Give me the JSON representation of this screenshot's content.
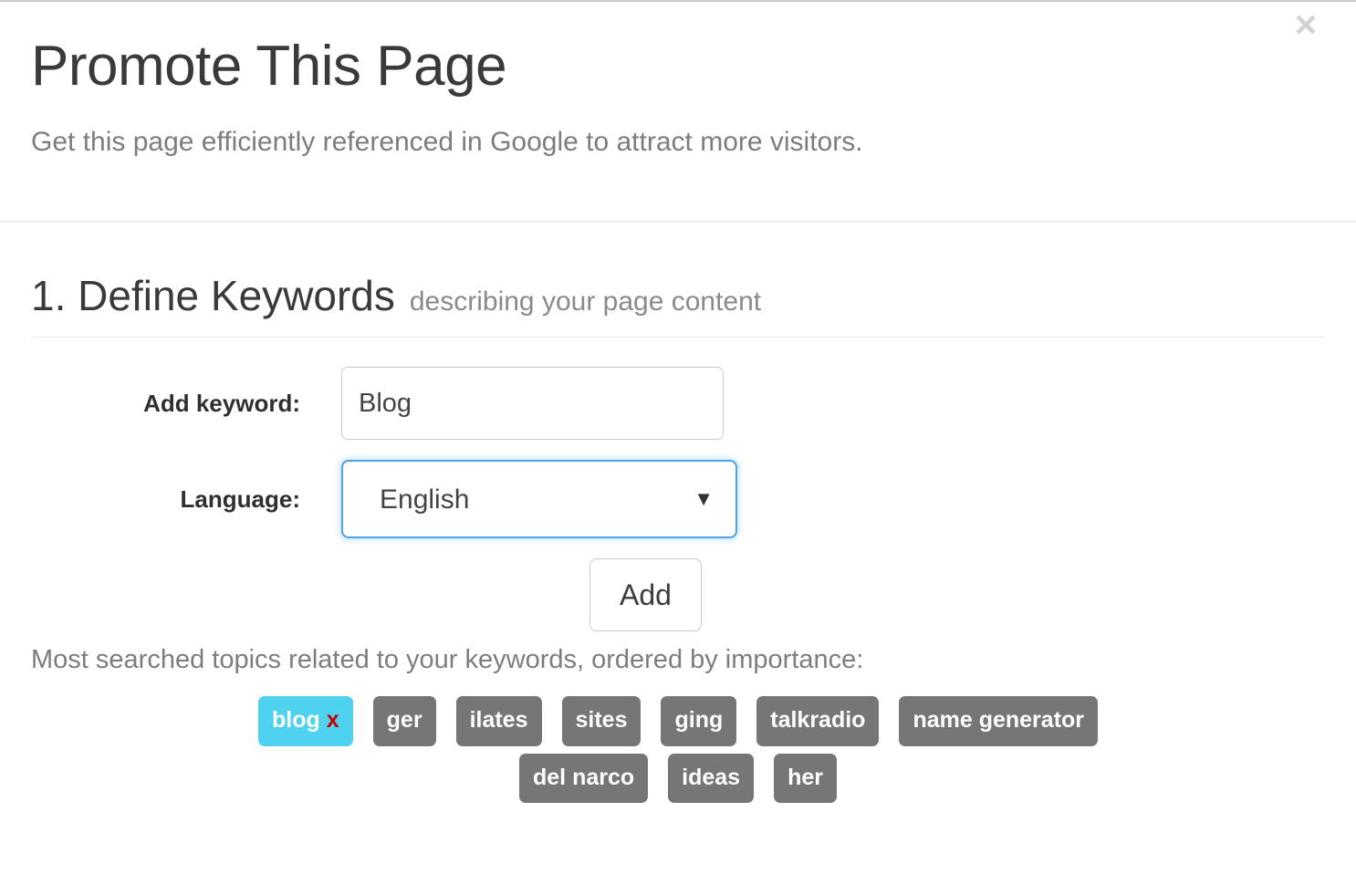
{
  "modal": {
    "close_icon": "close-icon",
    "close_glyph": "×",
    "title": "Promote This Page",
    "subtitle": "Get this page efficiently referenced in Google to attract more visitors."
  },
  "section": {
    "number_title": "1. Define Keywords",
    "sub_caption": "describing your page content"
  },
  "form": {
    "keyword_label": "Add keyword:",
    "keyword_value": "Blog",
    "keyword_placeholder": "",
    "language_label": "Language:",
    "language_value": "English",
    "language_caret": "▼",
    "language_options": [
      "English"
    ],
    "add_button": "Add"
  },
  "topics": {
    "note": "Most searched topics related to your keywords, ordered by importance:",
    "tags": [
      {
        "label": "blog",
        "selected": true,
        "remove_glyph": "x"
      },
      {
        "label": "ger",
        "selected": false
      },
      {
        "label": "ilates",
        "selected": false
      },
      {
        "label": "sites",
        "selected": false
      },
      {
        "label": "ging",
        "selected": false
      },
      {
        "label": "talkradio",
        "selected": false
      },
      {
        "label": "name generator",
        "selected": false
      },
      {
        "label": "del narco",
        "selected": false
      },
      {
        "label": "ideas",
        "selected": false
      },
      {
        "label": "her",
        "selected": false
      }
    ]
  },
  "colors": {
    "selected_tag_bg": "#4fd2ef",
    "tag_bg": "#767676",
    "remove_x": "#cc0000",
    "focus_border": "#4fa3e3",
    "title_text": "#3a3a3a",
    "muted_text": "#7d7d7d"
  }
}
